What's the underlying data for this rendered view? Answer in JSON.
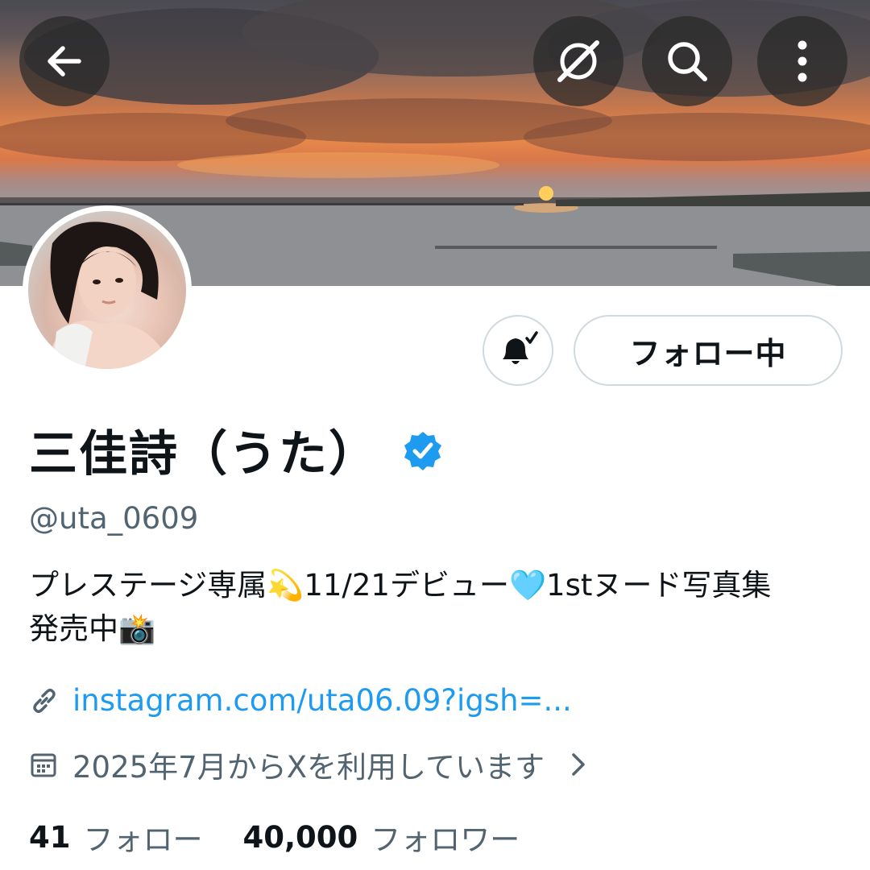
{
  "header": {
    "back_icon": "arrow-left-icon",
    "grok_icon": "grok-icon",
    "search_icon": "search-icon",
    "more_icon": "more-vertical-icon"
  },
  "profile": {
    "display_name": "三佳詩（うた）",
    "verified": true,
    "handle": "@uta_0609",
    "bio_line1": "プレステージ専属💫11/21デビュー🩵1stヌード写真集",
    "bio_line2": "発売中📸",
    "link_text": "instagram.com/uta06.09?igsh=...",
    "joined_text": "2025年7月からXを利用しています",
    "following_count": "41",
    "following_label": "フォロー",
    "followers_count": "40,000",
    "followers_label": "フォロワー"
  },
  "actions": {
    "notify_icon": "bell-check-icon",
    "follow_label": "フォロー中"
  },
  "colors": {
    "accent": "#1d9bf0",
    "secondary_text": "#536471",
    "border": "#cfd9de"
  }
}
